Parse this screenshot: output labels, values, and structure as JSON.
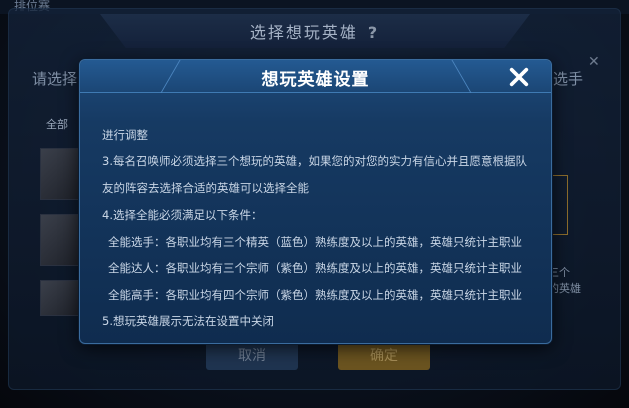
{
  "background": {
    "top_left_text": "排位赛",
    "header_title": "选择想玩英雄",
    "header_help": "?",
    "left_title": "请选择",
    "right_title": "选手",
    "tab_label": "全部",
    "side_text_1": "三个",
    "side_text_2": "的英雄",
    "cancel_label": "取消",
    "confirm_label": "确定"
  },
  "dialog": {
    "title": "想玩英雄设置",
    "close_icon": "close-x-icon",
    "lines": [
      "进行调整",
      "3.每名召唤师必须选择三个想玩的英雄，如果您的对您的实力有信心并且愿意根据队",
      "友的阵容去选择合适的英雄可以选择全能",
      "4.选择全能必须满足以下条件：",
      "全能选手：各职业均有三个精英（蓝色）熟练度及以上的英雄，英雄只统计主职业",
      "全能达人：各职业均有三个宗师（紫色）熟练度及以上的英雄，英雄只统计主职业",
      "全能高手：各职业均有四个宗师（紫色）熟练度及以上的英雄，英雄只统计主职业",
      "5.想玩英雄展示无法在设置中关闭"
    ]
  },
  "colors": {
    "dialog_bg": "#163a63",
    "dialog_border": "#3a6c9e",
    "body_text": "#c9d6e6",
    "confirm_gold": "#6b5420"
  }
}
